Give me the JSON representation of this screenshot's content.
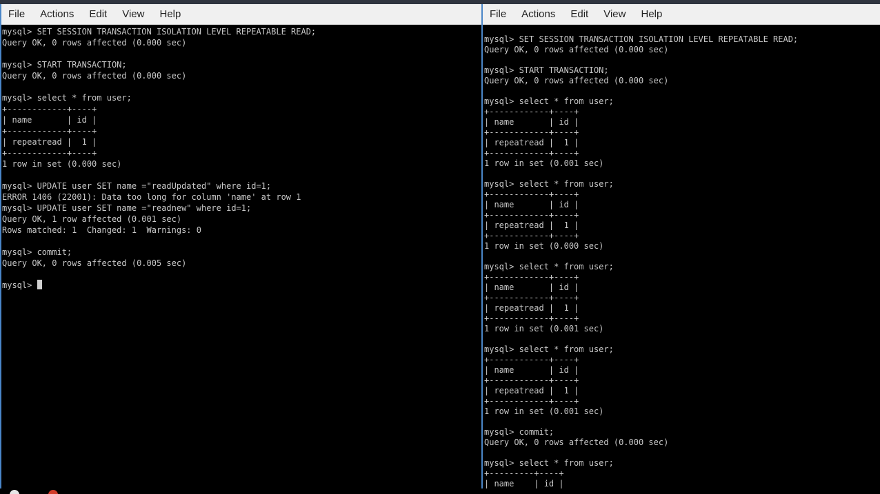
{
  "left_terminal": {
    "menu": [
      "File",
      "Actions",
      "Edit",
      "View",
      "Help"
    ],
    "lines": [
      "mysql> SET SESSION TRANSACTION ISOLATION LEVEL REPEATABLE READ;",
      "Query OK, 0 rows affected (0.000 sec)",
      "",
      "mysql> START TRANSACTION;",
      "Query OK, 0 rows affected (0.000 sec)",
      "",
      "mysql> select * from user;",
      "+------------+----+",
      "| name       | id |",
      "+------------+----+",
      "| repeatread |  1 |",
      "+------------+----+",
      "1 row in set (0.000 sec)",
      "",
      "mysql> UPDATE user SET name =\"readUpdated\" where id=1;",
      "ERROR 1406 (22001): Data too long for column 'name' at row 1",
      "mysql> UPDATE user SET name =\"readnew\" where id=1;",
      "Query OK, 1 row affected (0.001 sec)",
      "Rows matched: 1  Changed: 1  Warnings: 0",
      "",
      "mysql> commit;",
      "Query OK, 0 rows affected (0.005 sec)",
      ""
    ],
    "prompt": "mysql> "
  },
  "right_terminal": {
    "menu": [
      "File",
      "Actions",
      "Edit",
      "View",
      "Help"
    ],
    "lines": [
      "mysql> SET SESSION TRANSACTION ISOLATION LEVEL REPEATABLE READ;",
      "Query OK, 0 rows affected (0.000 sec)",
      "",
      "mysql> START TRANSACTION;",
      "Query OK, 0 rows affected (0.000 sec)",
      "",
      "mysql> select * from user;",
      "+------------+----+",
      "| name       | id |",
      "+------------+----+",
      "| repeatread |  1 |",
      "+------------+----+",
      "1 row in set (0.001 sec)",
      "",
      "mysql> select * from user;",
      "+------------+----+",
      "| name       | id |",
      "+------------+----+",
      "| repeatread |  1 |",
      "+------------+----+",
      "1 row in set (0.000 sec)",
      "",
      "mysql> select * from user;",
      "+------------+----+",
      "| name       | id |",
      "+------------+----+",
      "| repeatread |  1 |",
      "+------------+----+",
      "1 row in set (0.001 sec)",
      "",
      "mysql> select * from user;",
      "+------------+----+",
      "| name       | id |",
      "+------------+----+",
      "| repeatread |  1 |",
      "+------------+----+",
      "1 row in set (0.001 sec)",
      "",
      "mysql> commit;",
      "Query OK, 0 rows affected (0.000 sec)",
      "",
      "mysql> select * from user;",
      "+---------+----+",
      "| name    | id |"
    ]
  },
  "colors": {
    "menubar_bg": "#f0f0f0",
    "terminal_bg": "#000000",
    "terminal_fg": "#c8c8c8",
    "accent_border": "#4a86c8"
  }
}
